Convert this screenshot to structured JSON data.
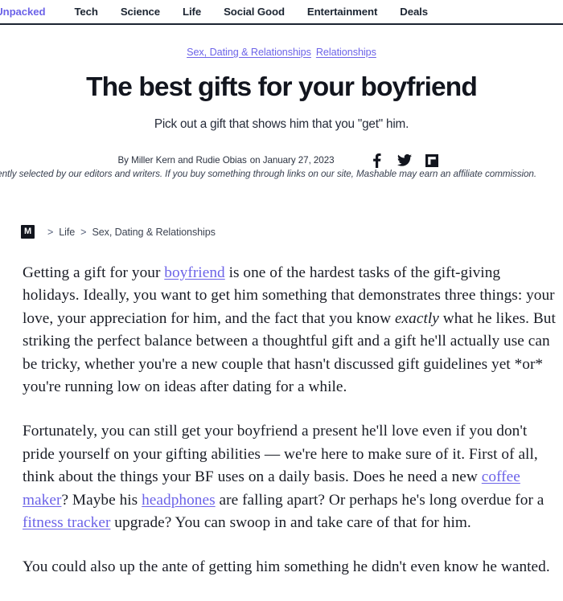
{
  "nav": {
    "items": [
      {
        "label": "Samsung Unpacked",
        "promo": true
      },
      {
        "label": "Tech",
        "promo": false
      },
      {
        "label": "Science",
        "promo": false
      },
      {
        "label": "Life",
        "promo": false
      },
      {
        "label": "Social Good",
        "promo": false
      },
      {
        "label": "Entertainment",
        "promo": false
      },
      {
        "label": "Deals",
        "promo": false
      }
    ]
  },
  "article": {
    "categories": [
      {
        "label": "Sex, Dating & Relationships"
      },
      {
        "label": "Relationships"
      }
    ],
    "headline": "The best gifts for your boyfriend",
    "subtitle": "Pick out a gift that shows him that you \"get\" him.",
    "byline": {
      "authors": "By Miller Kern and Rudie Obias",
      "date": "on January 27, 2023"
    },
    "social": [
      {
        "name": "facebook-icon",
        "label": "Facebook"
      },
      {
        "name": "twitter-icon",
        "label": "Twitter"
      },
      {
        "name": "flipboard-icon",
        "label": "Flipboard"
      }
    ],
    "disclaimer": "All products featured here are independently selected by our editors and writers. If you buy something through links on our site, Mashable may earn an affiliate commission.",
    "breadcrumb": {
      "logo_letter": "M",
      "separator": ">",
      "items": [
        {
          "label": "Life"
        },
        {
          "label": "Sex, Dating & Relationships"
        }
      ]
    },
    "paragraphs": {
      "p1_a": "Getting a gift for your ",
      "p1_link1": "boyfriend",
      "p1_b": " is one of the hardest tasks of the gift-giving holidays. Ideally, you want to get him something that demonstrates three things: your love, your appreciation for him, and the fact that you know ",
      "p1_em": "exactly",
      "p1_c": " what he likes. But striking the perfect balance between a thoughtful gift and a gift he'll actually use can be tricky, whether you're a new couple that hasn't discussed gift guidelines yet *or* you're running low on ideas after dating for a while.",
      "p2_a": "Fortunately, you can still get your boyfriend a present he'll love even if you don't pride yourself on your gifting abilities — we're here to make sure of it. First of all, think about the things your BF uses on a daily basis. Does he need a new ",
      "p2_link1": "coffee maker",
      "p2_b": "? Maybe his ",
      "p2_link2": "headphones",
      "p2_c": " are falling apart? Or perhaps he's long overdue for a ",
      "p2_link3": "fitness tracker",
      "p2_d": " upgrade? You can swoop in and take care of that for him.",
      "p3": "You could also up the ante of getting him something he didn't even know he wanted."
    }
  },
  "colors": {
    "accent": "#6c63e8",
    "ink": "#12151e",
    "body": "#1a1d26"
  }
}
